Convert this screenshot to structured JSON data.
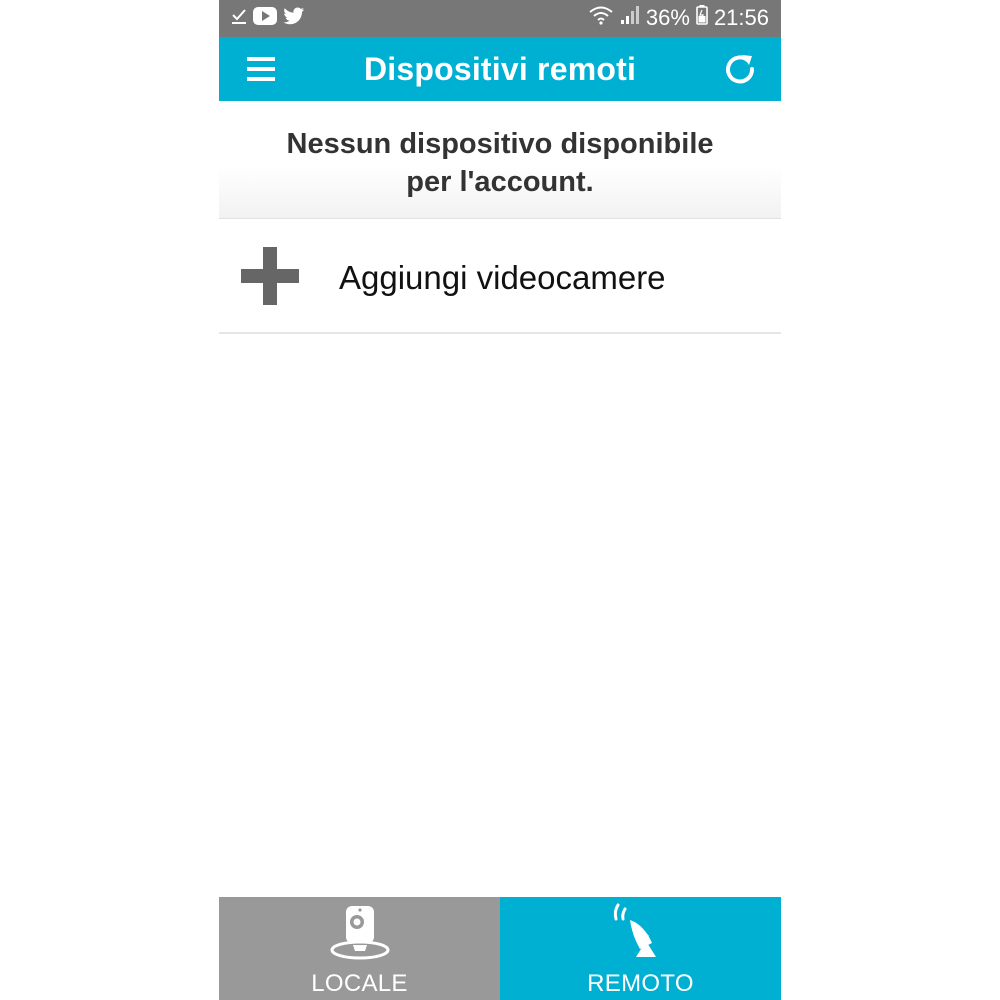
{
  "status_bar": {
    "battery_percent": "36%",
    "time": "21:56",
    "icons": [
      "download-done-icon",
      "youtube-icon",
      "twitter-icon",
      "wifi-icon",
      "signal-icon",
      "battery-icon"
    ]
  },
  "app_bar": {
    "title": "Dispositivi remoti",
    "menu_icon": "hamburger-menu-icon",
    "refresh_icon": "refresh-icon",
    "color": "#00b0d2"
  },
  "notice": {
    "line1": "Nessun dispositivo disponibile",
    "line2": "per l'account."
  },
  "add_row": {
    "label": "Aggiungi videocamere",
    "icon": "plus-icon"
  },
  "bottom_nav": {
    "tabs": [
      {
        "label": "LOCALE",
        "icon": "camera-icon",
        "selected": false,
        "color": "#999999"
      },
      {
        "label": "REMOTO",
        "icon": "satellite-dish-icon",
        "selected": true,
        "color": "#00b0d2"
      }
    ]
  }
}
